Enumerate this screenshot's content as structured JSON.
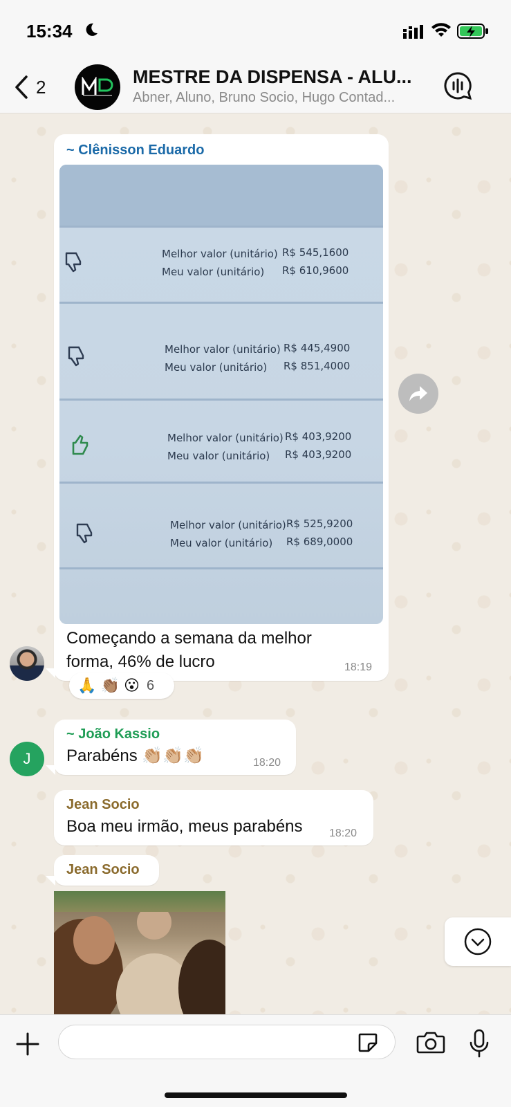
{
  "status_bar": {
    "time": "15:34"
  },
  "header": {
    "back_count": "2",
    "title": "MESTRE DA DISPENSA - ALU...",
    "members": "Abner, Aluno, Bruno Socio, Hugo Contad..."
  },
  "messages": [
    {
      "sender": "~ Clênisson Eduardo",
      "text_line1": "Começando a semana da melhor",
      "text_line2": "forma, 46% de lucro",
      "time": "18:19",
      "photo": {
        "rows": [
          {
            "label1": "Melhor valor (unitário)",
            "value1": "R$ 545,1600",
            "label2": "Meu valor (unitário)",
            "value2": "R$ 610,9600",
            "icon": "thumbs-down-icon"
          },
          {
            "label1": "Melhor valor (unitário)",
            "value1": "R$ 445,4900",
            "label2": "Meu valor (unitário)",
            "value2": "R$ 851,4000",
            "icon": "thumbs-down-icon"
          },
          {
            "label1": "Melhor valor (unitário)",
            "value1": "R$ 403,9200",
            "label2": "Meu valor (unitário)",
            "value2": "R$ 403,9200",
            "icon": "thumbs-up-icon"
          },
          {
            "label1": "Melhor valor (unitário)",
            "value1": "R$ 525,9200",
            "label2": "Meu valor (unitário)",
            "value2": "R$ 689,0000",
            "icon": "thumbs-down-icon"
          }
        ]
      },
      "reactions": {
        "emojis": "🙏 👏🏽 😮",
        "count": "6"
      }
    },
    {
      "sender": "~ João Kassio",
      "avatar_letter": "J",
      "text": "Parabéns 👏🏼👏🏼👏🏼",
      "time": "18:20"
    },
    {
      "sender": "Jean Socio",
      "text": "Boa meu irmão, meus parabéns",
      "time": "18:20"
    },
    {
      "sender": "Jean Socio",
      "media": "gif"
    }
  ],
  "input": {
    "placeholder": ""
  },
  "colors": {
    "chat_background": "#efeae2",
    "bubble": "#ffffff",
    "sender_blue": "#1b6aa8",
    "sender_green": "#1f9d55",
    "sender_brown": "#8a6a2c"
  }
}
